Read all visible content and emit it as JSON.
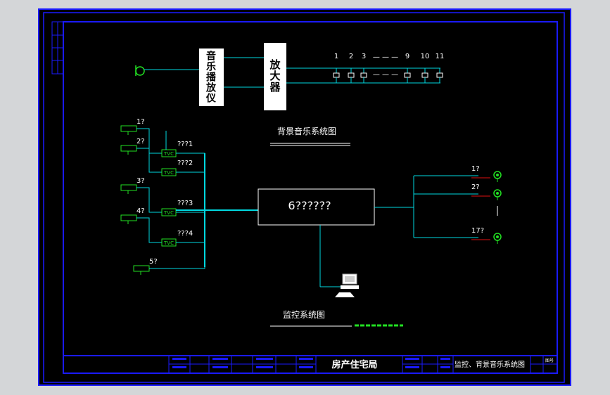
{
  "colors": {
    "background": "#d4d6d8",
    "sheet": "#000000",
    "frame": "#1a1aff",
    "cable": "#00d8e0",
    "device": "#22e022",
    "text": "#ffffff",
    "mark": "#e01010"
  },
  "bgm": {
    "player_label": "音乐播放仪",
    "amplifier_label": "放大器",
    "speaker_numbers": [
      "1",
      "2",
      "3",
      "9",
      "10",
      "11"
    ],
    "ellipsis": "— — —",
    "title": "背景音乐系统图"
  },
  "cctv": {
    "cameras": [
      {
        "label": "1?",
        "channel": "???1",
        "tvc": "TVC"
      },
      {
        "label": "2?",
        "channel": "???2",
        "tvc": "TVC"
      },
      {
        "label": "3?",
        "channel": "???3",
        "tvc": "TVC"
      },
      {
        "label": "4?",
        "channel": "???4",
        "tvc": "TVC"
      },
      {
        "label": "5?"
      }
    ],
    "controller_label": "6??????",
    "monitors": [
      "1?",
      "2?",
      "17?"
    ],
    "title": "监控系统图"
  },
  "title_block": {
    "company": "房产住宅局",
    "drawing_name": "监控、背景音乐系统图",
    "sheet_no": "图号"
  }
}
